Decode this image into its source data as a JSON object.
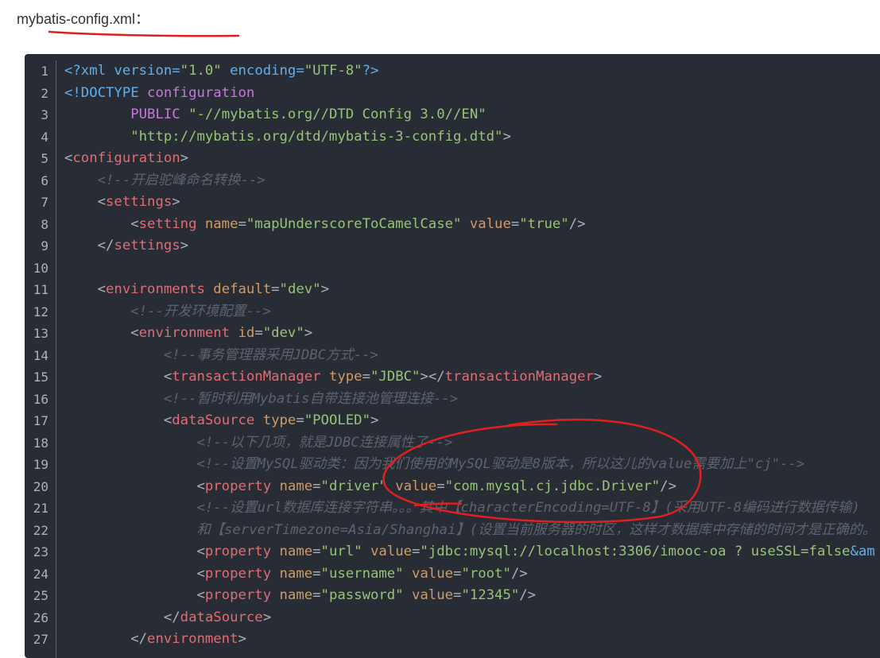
{
  "title": "mybatis-config.xml：",
  "annotation_color": "#e02020",
  "code": {
    "language": "xml",
    "lines": [
      [
        [
          "kw",
          "<?xml version="
        ],
        [
          "s",
          "\"1.0\""
        ],
        [
          "kw",
          " encoding="
        ],
        [
          "s",
          "\"UTF-8\""
        ],
        [
          "kw",
          "?>"
        ]
      ],
      [
        [
          "kw",
          "<!DOCTYPE "
        ],
        [
          "pu",
          "configuration"
        ]
      ],
      [
        [
          "p",
          "        "
        ],
        [
          "pu",
          "PUBLIC "
        ],
        [
          "s",
          "\"-//mybatis.org//DTD Config 3.0//EN\""
        ]
      ],
      [
        [
          "p",
          "        "
        ],
        [
          "s",
          "\"http://mybatis.org/dtd/mybatis-3-config.dtd\""
        ],
        [
          "p",
          ">"
        ]
      ],
      [
        [
          "p",
          "<"
        ],
        [
          "tg",
          "configuration"
        ],
        [
          "p",
          ">"
        ]
      ],
      [
        [
          "cm",
          "    <!--开启驼峰命名转换-->"
        ]
      ],
      [
        [
          "p",
          "    <"
        ],
        [
          "tg",
          "settings"
        ],
        [
          "p",
          ">"
        ]
      ],
      [
        [
          "p",
          "        <"
        ],
        [
          "tg",
          "setting "
        ],
        [
          "at",
          "name"
        ],
        [
          "p",
          "="
        ],
        [
          "s",
          "\"mapUnderscoreToCamelCase\""
        ],
        [
          "p",
          " "
        ],
        [
          "at",
          "value"
        ],
        [
          "p",
          "="
        ],
        [
          "s",
          "\"true\""
        ],
        [
          "p",
          "/>"
        ]
      ],
      [
        [
          "p",
          "    </"
        ],
        [
          "tg",
          "settings"
        ],
        [
          "p",
          ">"
        ]
      ],
      [
        [
          "p",
          ""
        ]
      ],
      [
        [
          "p",
          "    <"
        ],
        [
          "tg",
          "environments "
        ],
        [
          "at",
          "default"
        ],
        [
          "p",
          "="
        ],
        [
          "s",
          "\"dev\""
        ],
        [
          "p",
          ">"
        ]
      ],
      [
        [
          "cm",
          "        <!--开发环境配置-->"
        ]
      ],
      [
        [
          "p",
          "        <"
        ],
        [
          "tg",
          "environment "
        ],
        [
          "at",
          "id"
        ],
        [
          "p",
          "="
        ],
        [
          "s",
          "\"dev\""
        ],
        [
          "p",
          ">"
        ]
      ],
      [
        [
          "cm",
          "            <!--事务管理器采用JDBC方式-->"
        ]
      ],
      [
        [
          "p",
          "            <"
        ],
        [
          "tg",
          "transactionManager "
        ],
        [
          "at",
          "type"
        ],
        [
          "p",
          "="
        ],
        [
          "s",
          "\"JDBC\""
        ],
        [
          "p",
          "></"
        ],
        [
          "tg",
          "transactionManager"
        ],
        [
          "p",
          ">"
        ]
      ],
      [
        [
          "cm",
          "            <!--暂时利用Mybatis自带连接池管理连接-->"
        ]
      ],
      [
        [
          "p",
          "            <"
        ],
        [
          "tg",
          "dataSource "
        ],
        [
          "at",
          "type"
        ],
        [
          "p",
          "="
        ],
        [
          "s",
          "\"POOLED\""
        ],
        [
          "p",
          ">"
        ]
      ],
      [
        [
          "cm",
          "                <!--以下几项，就是JDBC连接属性了-->"
        ]
      ],
      [
        [
          "cm",
          "                <!--设置MySQL驱动类：因为我们使用的MySQL驱动是8版本，所以这儿的value需要加上\"cj\"-->"
        ]
      ],
      [
        [
          "p",
          "                <"
        ],
        [
          "tg",
          "property "
        ],
        [
          "at",
          "name"
        ],
        [
          "p",
          "="
        ],
        [
          "s",
          "\"driver\""
        ],
        [
          "p",
          " "
        ],
        [
          "at",
          "value"
        ],
        [
          "p",
          "="
        ],
        [
          "s",
          "\"com.mysql.cj.jdbc.Driver\""
        ],
        [
          "p",
          "/>"
        ]
      ],
      [
        [
          "cm",
          "                <!--设置url数据库连接字符串。。。其中【characterEncoding=UTF-8】(采用UTF-8编码进行数据传输)"
        ]
      ],
      [
        [
          "cm",
          "                和【serverTimezone=Asia/Shanghai】(设置当前服务器的时区，这样才数据库中存储的时间才是正确的。"
        ]
      ],
      [
        [
          "p",
          "                <"
        ],
        [
          "tg",
          "property "
        ],
        [
          "at",
          "name"
        ],
        [
          "p",
          "="
        ],
        [
          "s",
          "\"url\""
        ],
        [
          "p",
          " "
        ],
        [
          "at",
          "value"
        ],
        [
          "p",
          "="
        ],
        [
          "s",
          "\"jdbc:mysql://localhost:3306/imooc-oa ? useSSL=false"
        ],
        [
          "kw",
          "&am"
        ]
      ],
      [
        [
          "p",
          "                <"
        ],
        [
          "tg",
          "property "
        ],
        [
          "at",
          "name"
        ],
        [
          "p",
          "="
        ],
        [
          "s",
          "\"username\""
        ],
        [
          "p",
          " "
        ],
        [
          "at",
          "value"
        ],
        [
          "p",
          "="
        ],
        [
          "s",
          "\"root\""
        ],
        [
          "p",
          "/>"
        ]
      ],
      [
        [
          "p",
          "                <"
        ],
        [
          "tg",
          "property "
        ],
        [
          "at",
          "name"
        ],
        [
          "p",
          "="
        ],
        [
          "s",
          "\"password\""
        ],
        [
          "p",
          " "
        ],
        [
          "at",
          "value"
        ],
        [
          "p",
          "="
        ],
        [
          "s",
          "\"12345\""
        ],
        [
          "p",
          "/>"
        ]
      ],
      [
        [
          "p",
          "            </"
        ],
        [
          "tg",
          "dataSource"
        ],
        [
          "p",
          ">"
        ]
      ],
      [
        [
          "p",
          "        </"
        ],
        [
          "tg",
          "environment"
        ],
        [
          "p",
          ">"
        ]
      ]
    ]
  }
}
